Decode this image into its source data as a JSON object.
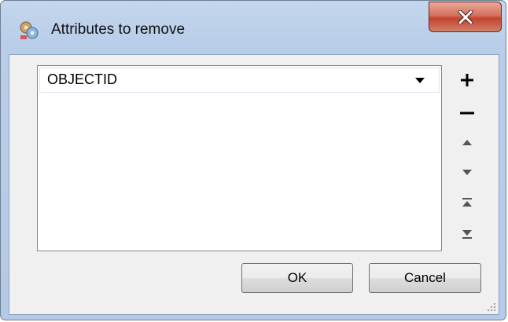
{
  "window": {
    "title": "Attributes to remove"
  },
  "list": {
    "items": [
      "OBJECTID"
    ]
  },
  "side_buttons": [
    {
      "name": "add-button",
      "icon": "plus-icon"
    },
    {
      "name": "remove-button",
      "icon": "minus-icon"
    },
    {
      "name": "move-up-button",
      "icon": "arrow-up-icon"
    },
    {
      "name": "move-down-button",
      "icon": "arrow-down-icon"
    },
    {
      "name": "move-top-button",
      "icon": "arrow-top-icon"
    },
    {
      "name": "move-bottom-button",
      "icon": "arrow-bottom-icon"
    }
  ],
  "buttons": {
    "ok_label": "OK",
    "cancel_label": "Cancel"
  },
  "colors": {
    "close_button": "#c2432d",
    "frame": "#b8cde8",
    "client": "#f0f0f0"
  }
}
